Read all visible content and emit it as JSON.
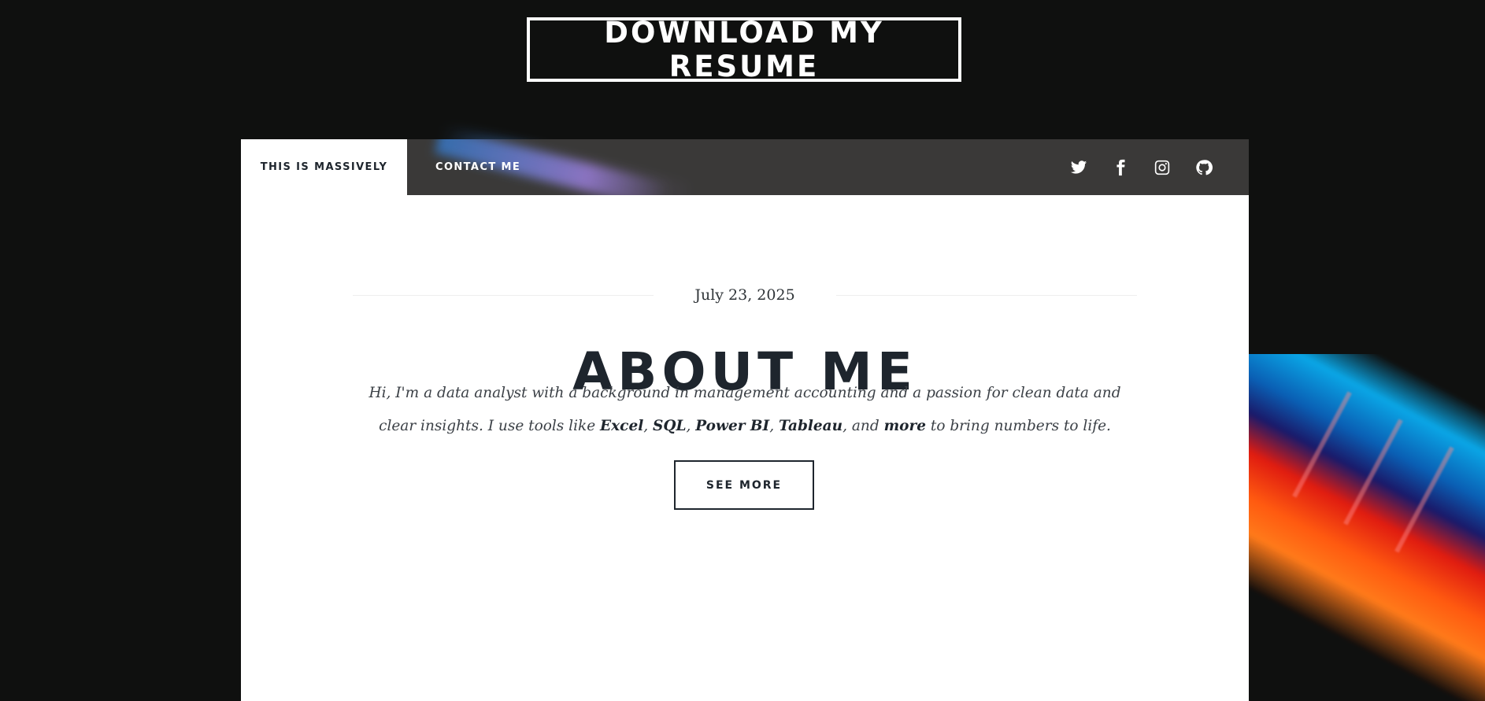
{
  "header": {
    "resume_button": "DOWNLOAD MY RESUME"
  },
  "nav": {
    "tabs": [
      {
        "label": "THIS IS MASSIVELY",
        "active": true
      },
      {
        "label": "CONTACT ME",
        "active": false
      }
    ],
    "social_icons": [
      "twitter-icon",
      "facebook-icon",
      "instagram-icon",
      "github-icon"
    ]
  },
  "post": {
    "date": "July 23, 2025",
    "title": "ABOUT ME",
    "intro": {
      "part1": "Hi, I'm a data analyst with a background in management accounting and a passion for clean data and clear insights. I use tools like ",
      "tool1": "Excel",
      "sep1": ", ",
      "tool2": "SQL",
      "sep2": ", ",
      "tool3": "Power BI",
      "sep3": ", ",
      "tool4": "Tableau",
      "sep4": ", and ",
      "tool5": "more",
      "part2": " to bring numbers to life."
    },
    "button": "SEE MORE"
  },
  "colors": {
    "background": "#0f100f",
    "nav_bar": "#41403f",
    "heading": "#1e252d",
    "panel": "#ffffff"
  }
}
